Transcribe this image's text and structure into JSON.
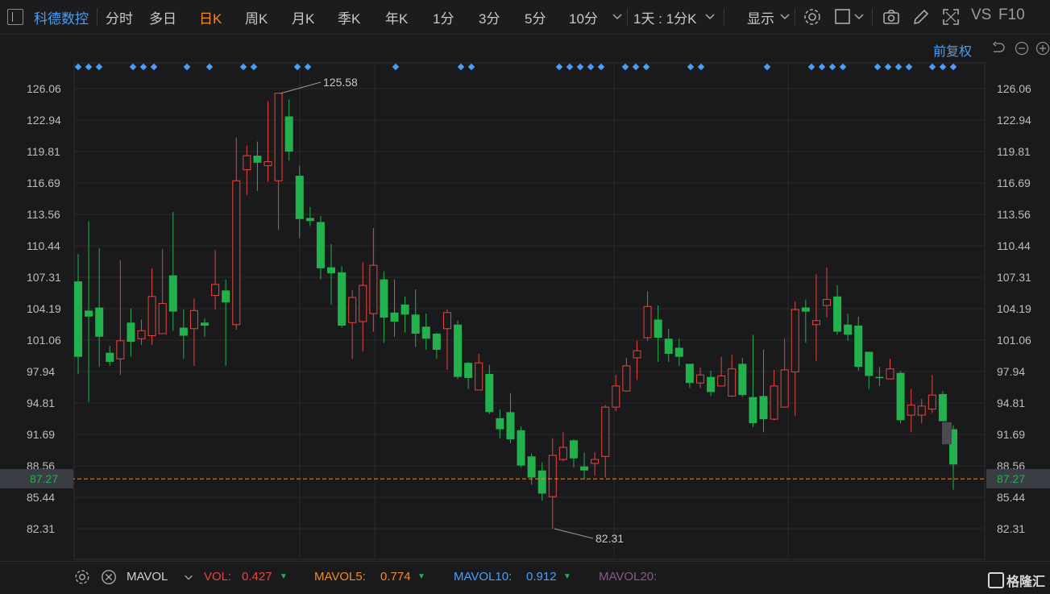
{
  "header": {
    "stock_name": "科德数控",
    "periods": [
      "分时",
      "多日",
      "日K",
      "周K",
      "月K",
      "季K",
      "年K",
      "1分",
      "3分",
      "5分",
      "10分"
    ],
    "active_period": "日K",
    "interval_select": "1天 : 1分K",
    "display_label": "显示",
    "vs_label": "VS",
    "f10_label": "F10"
  },
  "adjust_label": "前复权",
  "colors": {
    "up": "#e5463f",
    "down": "#22b14c",
    "accent": "#f08a2b",
    "blue": "#4a9ff5",
    "muted": "#a0a0a0"
  },
  "chart_data": {
    "type": "candlestick",
    "y_ticks": [
      "126.06",
      "122.94",
      "119.81",
      "116.69",
      "113.56",
      "110.44",
      "107.31",
      "104.19",
      "101.06",
      "97.94",
      "94.81",
      "91.69",
      "88.56",
      "85.44",
      "82.31"
    ],
    "ylim": [
      80.0,
      128.0
    ],
    "current_price": "87.27",
    "max_label": "125.58",
    "min_label": "82.31",
    "candles": [
      [
        106.9,
        99.4,
        109.6,
        97.7
      ],
      [
        104.0,
        103.4,
        112.9,
        94.9
      ],
      [
        104.3,
        101.4,
        110.2,
        98.4
      ],
      [
        99.8,
        98.9,
        100.5,
        98.5
      ],
      [
        99.2,
        101.0,
        109.0,
        97.6
      ],
      [
        102.8,
        100.9,
        104.2,
        99.4
      ],
      [
        101.2,
        102.0,
        103.1,
        100.6
      ],
      [
        101.5,
        105.4,
        108.2,
        100.6
      ],
      [
        101.7,
        104.7,
        110.1,
        102.1
      ],
      [
        107.5,
        103.9,
        113.8,
        102.0
      ],
      [
        102.3,
        101.5,
        104.1,
        99.2
      ],
      [
        102.2,
        104.0,
        105.2,
        98.5
      ],
      [
        102.8,
        102.5,
        103.2,
        101.4
      ],
      [
        105.5,
        106.6,
        110.0,
        104.1
      ],
      [
        106.0,
        104.8,
        107.1,
        98.5
      ],
      [
        102.6,
        116.9,
        121.2,
        102.1
      ],
      [
        118.0,
        119.4,
        120.4,
        115.5
      ],
      [
        119.4,
        118.7,
        120.8,
        115.9
      ],
      [
        118.4,
        118.8,
        124.8,
        116.8
      ],
      [
        116.9,
        125.6,
        125.6,
        112.0
      ],
      [
        123.3,
        119.8,
        125.0,
        118.9
      ],
      [
        117.4,
        113.1,
        118.4,
        111.2
      ],
      [
        113.2,
        112.9,
        114.3,
        112.4
      ],
      [
        112.8,
        108.2,
        113.4,
        107.1
      ],
      [
        108.3,
        107.7,
        110.6,
        104.6
      ],
      [
        107.8,
        102.5,
        108.4,
        102.3
      ],
      [
        102.8,
        105.3,
        106.0,
        99.2
      ],
      [
        102.9,
        106.5,
        108.8,
        99.9
      ],
      [
        103.7,
        108.5,
        112.2,
        101.9
      ],
      [
        107.1,
        103.3,
        107.9,
        100.8
      ],
      [
        103.8,
        102.9,
        107.1,
        101.4
      ],
      [
        104.6,
        103.6,
        105.4,
        101.8
      ],
      [
        103.6,
        101.7,
        106.1,
        100.4
      ],
      [
        102.4,
        101.2,
        103.7,
        100.1
      ],
      [
        101.7,
        100.1,
        101.8,
        99.2
      ],
      [
        102.2,
        103.8,
        104.1,
        98.1
      ],
      [
        102.6,
        97.4,
        103.0,
        97.2
      ],
      [
        98.8,
        97.3,
        98.9,
        96.2
      ],
      [
        96.1,
        98.8,
        99.7,
        96.2
      ],
      [
        97.7,
        93.9,
        98.6,
        93.7
      ],
      [
        93.3,
        92.2,
        94.2,
        91.3
      ],
      [
        93.9,
        91.2,
        95.8,
        90.8
      ],
      [
        92.1,
        88.6,
        92.5,
        88.4
      ],
      [
        89.5,
        87.4,
        89.8,
        86.7
      ],
      [
        88.1,
        85.8,
        88.9,
        85.1
      ],
      [
        85.5,
        89.6,
        91.3,
        82.3
      ],
      [
        89.2,
        90.4,
        91.9,
        89.0
      ],
      [
        91.1,
        89.3,
        91.2,
        88.4
      ],
      [
        88.5,
        88.1,
        89.9,
        87.2
      ],
      [
        88.8,
        89.2,
        89.9,
        87.6
      ],
      [
        89.5,
        94.4,
        94.6,
        87.4
      ],
      [
        94.4,
        96.5,
        97.6,
        94.0
      ],
      [
        96.0,
        98.5,
        99.3,
        96.0
      ],
      [
        99.3,
        100.0,
        101.0,
        97.1
      ],
      [
        101.3,
        104.4,
        105.9,
        101.0
      ],
      [
        103.1,
        101.3,
        104.5,
        98.9
      ],
      [
        101.2,
        99.7,
        102.2,
        98.9
      ],
      [
        100.3,
        99.4,
        101.2,
        98.5
      ],
      [
        98.7,
        96.8,
        98.7,
        96.3
      ],
      [
        96.8,
        97.6,
        98.3,
        96.3
      ],
      [
        97.4,
        95.9,
        98.0,
        95.5
      ],
      [
        96.5,
        97.5,
        99.4,
        96.6
      ],
      [
        95.5,
        98.2,
        99.6,
        95.4
      ],
      [
        98.7,
        95.6,
        99.3,
        95.4
      ],
      [
        95.4,
        92.8,
        101.6,
        92.4
      ],
      [
        95.5,
        93.2,
        100.1,
        91.9
      ],
      [
        93.2,
        96.5,
        98.1,
        93.1
      ],
      [
        94.4,
        98.1,
        101.2,
        94.4
      ],
      [
        97.9,
        104.1,
        104.9,
        93.5
      ],
      [
        104.3,
        103.9,
        105.1,
        100.8
      ],
      [
        102.6,
        103.0,
        107.6,
        99.0
      ],
      [
        104.5,
        105.1,
        108.3,
        103.3
      ],
      [
        105.4,
        101.9,
        106.5,
        101.6
      ],
      [
        102.6,
        101.6,
        103.7,
        101.0
      ],
      [
        102.5,
        98.4,
        103.4,
        98.0
      ],
      [
        99.9,
        97.5,
        99.9,
        96.2
      ],
      [
        97.4,
        97.3,
        98.4,
        96.5
      ],
      [
        97.2,
        98.2,
        99.2,
        97.5
      ],
      [
        97.8,
        93.1,
        98.0,
        92.8
      ],
      [
        93.6,
        94.6,
        96.2,
        91.9
      ],
      [
        93.6,
        94.5,
        95.2,
        92.8
      ],
      [
        94.2,
        95.6,
        97.6,
        93.8
      ],
      [
        95.7,
        93.0,
        96.0,
        93.0
      ],
      [
        92.2,
        88.7,
        92.6,
        86.2
      ]
    ]
  },
  "volume_bar": {
    "indicator": "MAVOL",
    "vol_label": "VOL:",
    "vol_value": "0.427",
    "ma5_label": "MAVOL5:",
    "ma5_value": "0.774",
    "ma10_label": "MAVOL10:",
    "ma10_value": "0.912",
    "ma20_label": "MAVOL20:"
  },
  "logo_text": "格隆汇"
}
